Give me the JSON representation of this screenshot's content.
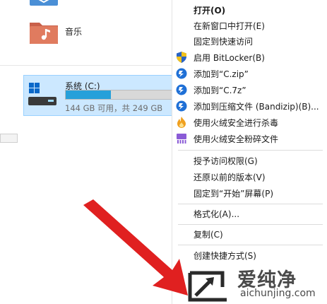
{
  "explorer": {
    "music_folder": {
      "label": "音乐",
      "icon": "music-folder-icon"
    },
    "drive": {
      "name": "系统 (C:)",
      "space_text": "144 GB 可用，共 249 GB",
      "used_fraction": 0.42,
      "icon": "windows-drive-icon"
    }
  },
  "context_menu": {
    "open": "打开(O)",
    "open_new_window": "在新窗口中打开(E)",
    "pin_quick_access": "固定到快速访问",
    "bitlocker": "启用 BitLocker(B)",
    "add_zip": "添加到“C.zip”",
    "add_7z": "添加到“C.7z”",
    "add_archive": "添加到压缩文件 (Bandizip)(B)...",
    "huorong_scan": "使用火绒安全进行杀毒",
    "huorong_shred": "使用火绒安全粉碎文件",
    "grant_access": "授予访问权限(G)",
    "restore_versions": "还原以前的版本(V)",
    "pin_start": "固定到“开始”屏幕(P)",
    "format": "格式化(A)...",
    "copy": "复制(C)",
    "create_shortcut": "创建快捷方式(S)"
  },
  "watermark": {
    "name": "爱纯净",
    "domain": "aichunjing.com"
  },
  "colors": {
    "selection_bg": "#cce8ff",
    "bar_fill": "#26a0da",
    "arrow": "#e02020",
    "folder": "#e07b5f",
    "bandizip": "#1f70d6",
    "huorong": "#f0a020",
    "shred": "#8a5bd6"
  }
}
